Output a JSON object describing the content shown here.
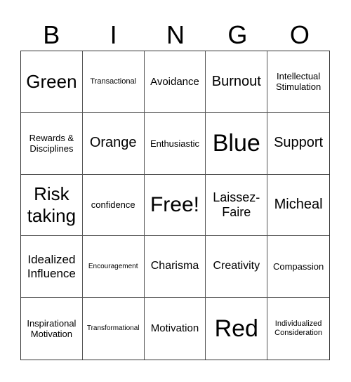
{
  "header": [
    "B",
    "I",
    "N",
    "G",
    "O"
  ],
  "cells": [
    "Green",
    "Transactional",
    "Avoidance",
    "Burnout",
    "Intellectual Stimulation",
    "Rewards & Disciplines",
    "Orange",
    "Enthusiastic",
    "Blue",
    "Support",
    "Risk taking",
    "confidence",
    "Free!",
    "Laissez-Faire",
    "Micheal",
    "Idealized Influence",
    "Encouragement",
    "Charisma",
    "Creativity",
    "Compassion",
    "Inspirational Motivation",
    "Transformational",
    "Motivation",
    "Red",
    "Individualized Consideration"
  ]
}
